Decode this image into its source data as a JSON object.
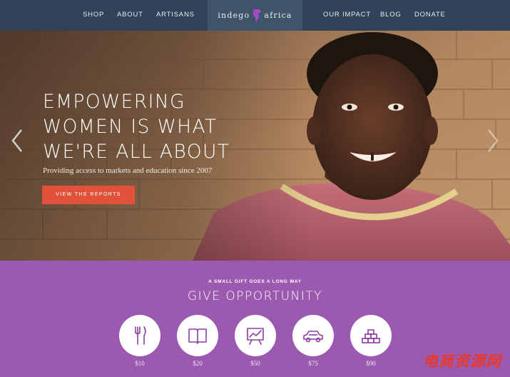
{
  "nav": {
    "left": [
      "SHOP",
      "ABOUT",
      "ARTISANS"
    ],
    "right": [
      "OUR IMPACT",
      "BLOG",
      "DONATE"
    ],
    "logo_left": "indego",
    "logo_right": "africa"
  },
  "hero": {
    "title": "EMPOWERING WOMEN IS WHAT WE'RE ALL ABOUT",
    "subtitle": "Providing access to markets and education since 2007",
    "cta": "VIEW THE REPORTS"
  },
  "give": {
    "kicker": "A SMALL GIFT GOES A LONG WAY",
    "title": "GIVE OPPORTUNITY",
    "amounts": [
      {
        "label": "$10",
        "icon": "fork-knife-icon"
      },
      {
        "label": "$20",
        "icon": "book-icon"
      },
      {
        "label": "$50",
        "icon": "chart-board-icon"
      },
      {
        "label": "$75",
        "icon": "car-icon"
      },
      {
        "label": "$90",
        "icon": "bricks-icon"
      }
    ]
  },
  "watermark": "电商资源网",
  "colors": {
    "nav_bg": "#2f4257",
    "accent_purple": "#9b59b0",
    "cta_red": "#e2523a",
    "icon_purple": "#8e3fa6"
  }
}
